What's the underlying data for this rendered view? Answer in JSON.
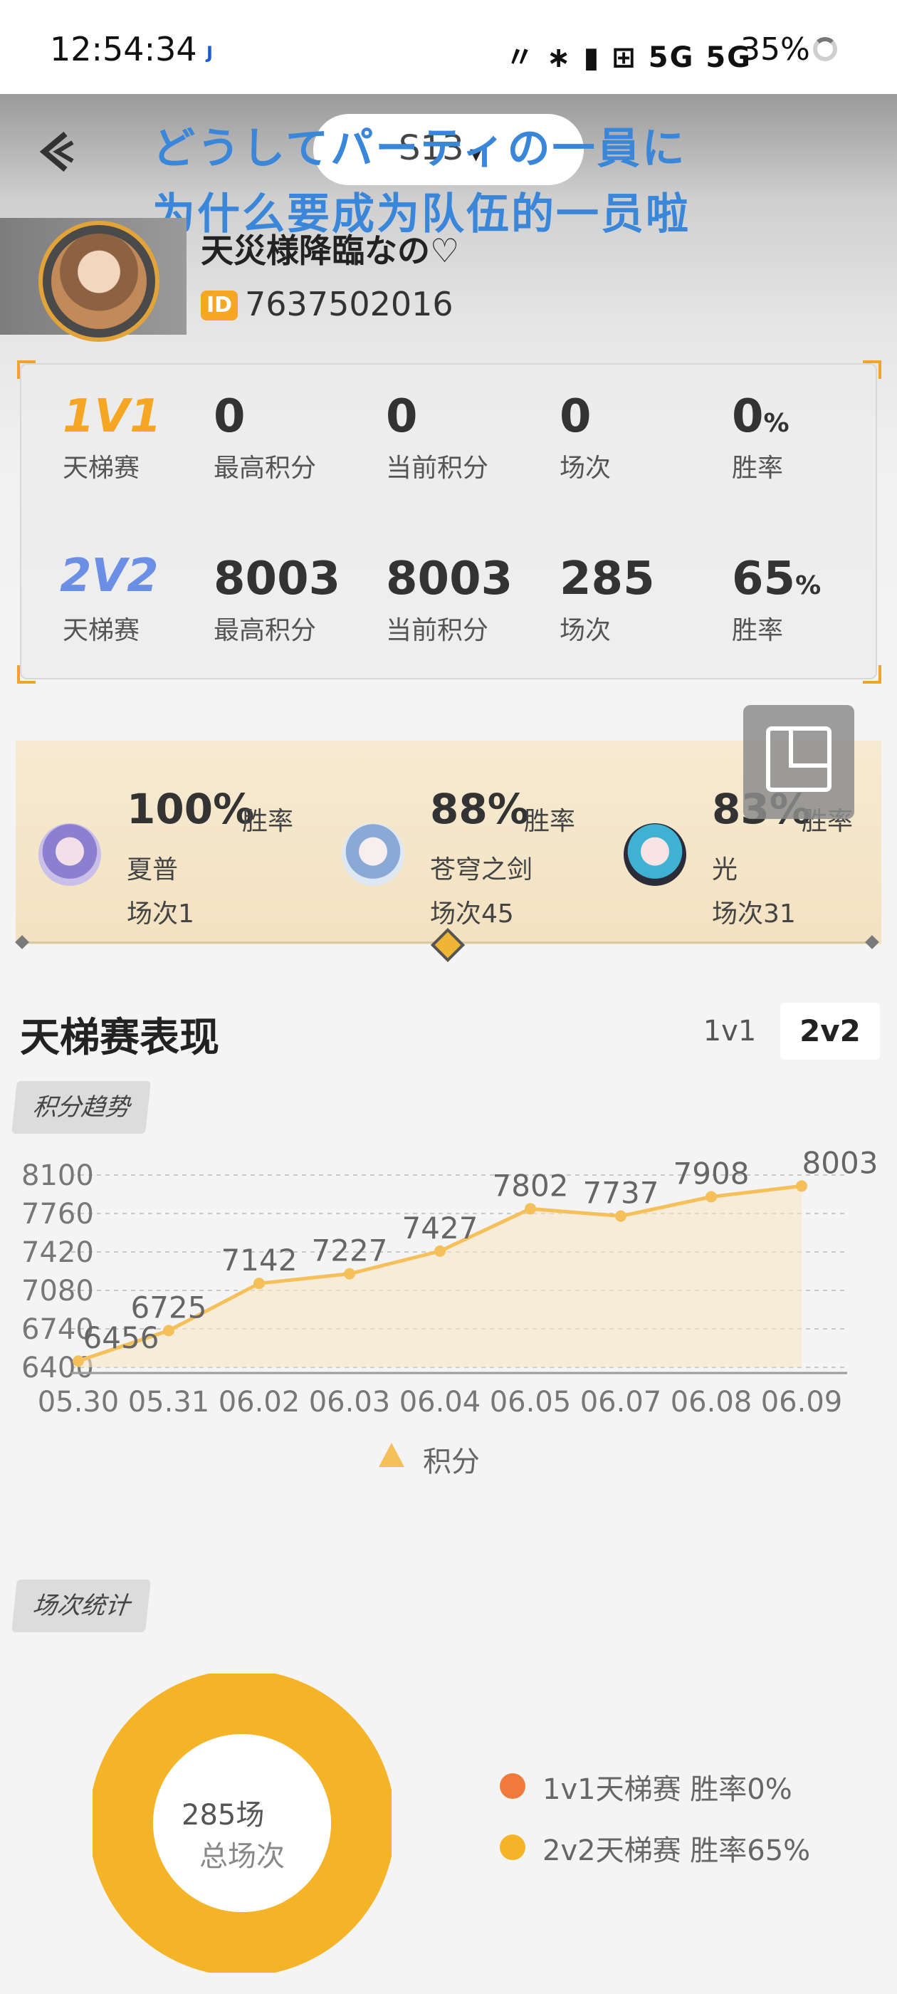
{
  "status_bar": {
    "time": "12:54:34",
    "app_badge": "J",
    "icons": "〃 ∗ ▮ ⊞ 5G 5G",
    "battery": "35%"
  },
  "header": {
    "season": "S13",
    "caret": "▾",
    "overlay_line1": "どうしてパーティの一員に",
    "overlay_line2": "为什么要成为队伍的一员啦",
    "player_name": "天災様降臨なの♡",
    "id_badge": "ID",
    "player_id": "7637502016"
  },
  "rank_stats": {
    "rows": [
      {
        "mode": "1V1",
        "mode_label": "天梯赛",
        "max_score": "0",
        "max_score_label": "最高积分",
        "current_score": "0",
        "current_score_label": "当前积分",
        "matches": "0",
        "matches_label": "场次",
        "win_rate": "0",
        "win_rate_unit": "%",
        "win_rate_label": "胜率"
      },
      {
        "mode": "2V2",
        "mode_label": "天梯赛",
        "max_score": "8003",
        "max_score_label": "最高积分",
        "current_score": "8003",
        "current_score_label": "当前积分",
        "matches": "285",
        "matches_label": "场次",
        "win_rate": "65",
        "win_rate_unit": "%",
        "win_rate_label": "胜率"
      }
    ]
  },
  "top_heroes": [
    {
      "win_rate": "100%",
      "win_rate_label": "胜率",
      "name": "夏普",
      "matches": "场次1"
    },
    {
      "win_rate": "88%",
      "win_rate_label": "胜率",
      "name": "苍穹之剑",
      "matches": "场次45"
    },
    {
      "win_rate": "83%",
      "win_rate_label": "胜率",
      "name": "光",
      "matches": "场次31"
    }
  ],
  "performance": {
    "title": "天梯赛表现",
    "tabs": [
      "1v1",
      "2v2"
    ],
    "selected_tab": "2v2",
    "trend_chip": "积分趋势",
    "stats_chip": "场次统计",
    "legend_label": "积分"
  },
  "chart_data": [
    {
      "type": "area",
      "categories": [
        "05.30",
        "05.31",
        "06.02",
        "06.03",
        "06.04",
        "06.05",
        "06.07",
        "06.08",
        "06.09"
      ],
      "series": [
        {
          "name": "积分",
          "values": [
            6456,
            6725,
            7142,
            7227,
            7427,
            7802,
            7737,
            7908,
            8003
          ]
        }
      ],
      "yticks": [
        8100,
        7760,
        7420,
        7080,
        6740,
        6400
      ],
      "ylim": [
        6400,
        8100
      ],
      "grid": true,
      "legend": "bottom",
      "color": "#f5c05a"
    },
    {
      "type": "pie",
      "center_value": "285场",
      "center_label": "总场次",
      "slices": [
        {
          "label": "1v1天梯赛 胜率0%",
          "value": 0,
          "color": "#f07a3c"
        },
        {
          "label": "2v2天梯赛 胜率65%",
          "value": 285,
          "color": "#f5b427"
        }
      ]
    }
  ]
}
